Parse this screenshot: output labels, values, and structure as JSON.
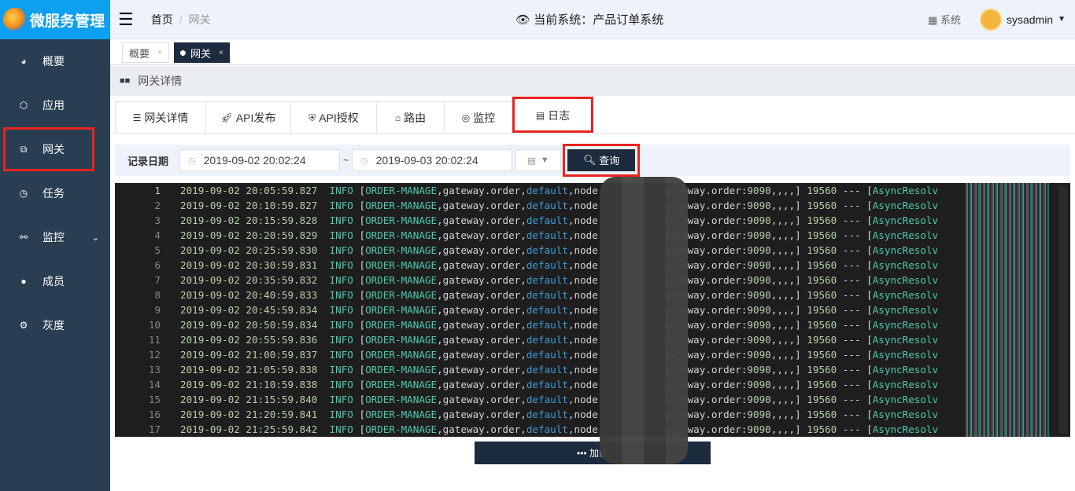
{
  "brand": "微服务管理",
  "sidebar": {
    "items": [
      {
        "label": "概要",
        "icon": "dashboard-icon"
      },
      {
        "label": "应用",
        "icon": "cube-icon"
      },
      {
        "label": "网关",
        "icon": "gateway-icon",
        "active": true
      },
      {
        "label": "任务",
        "icon": "clock-icon"
      },
      {
        "label": "监控",
        "icon": "monitor-icon",
        "expandable": true
      },
      {
        "label": "成员",
        "icon": "user-icon"
      },
      {
        "label": "灰度",
        "icon": "gears-icon"
      }
    ]
  },
  "header": {
    "breadcrumb": [
      "首页",
      "网关"
    ],
    "system": "当前系统：产品订单系统",
    "system_button": "系统",
    "user": "sysadmin"
  },
  "page_tabs": [
    {
      "label": "概要"
    },
    {
      "label": "网关",
      "active": true
    }
  ],
  "section_title": "网关详情",
  "sub_tabs": [
    {
      "label": "网关详情"
    },
    {
      "label": "API发布"
    },
    {
      "label": "API授权"
    },
    {
      "label": "路由"
    },
    {
      "label": "监控"
    },
    {
      "label": "日志",
      "active": true
    }
  ],
  "filter": {
    "label": "记录日期",
    "start": "2019-09-02 20:02:24",
    "separator": "~",
    "end": "2019-09-03 20:02:24",
    "query": "查询"
  },
  "log": {
    "level": "INFO",
    "app": "ORDER-MANAGE",
    "gateway": "gateway.order",
    "group": "default",
    "node_prefix": "node",
    "host_prefix": "gateway.order:",
    "port": "9090",
    "suffix": ",,,,]",
    "pid": "19560",
    "dashes": "---",
    "thread": "AsyncResolv",
    "timestamps": [
      "2019-09-02 20:05:59.827",
      "2019-09-02 20:10:59.827",
      "2019-09-02 20:15:59.828",
      "2019-09-02 20:20:59.829",
      "2019-09-02 20:25:59.830",
      "2019-09-02 20:30:59.831",
      "2019-09-02 20:35:59.832",
      "2019-09-02 20:40:59.833",
      "2019-09-02 20:45:59.834",
      "2019-09-02 20:50:59.834",
      "2019-09-02 20:55:59.836",
      "2019-09-02 21:00:59.837",
      "2019-09-02 21:05:59.838",
      "2019-09-02 21:10:59.838",
      "2019-09-02 21:15:59.840",
      "2019-09-02 21:20:59.841",
      "2019-09-02 21:25:59.842"
    ]
  },
  "load_more": "加载"
}
